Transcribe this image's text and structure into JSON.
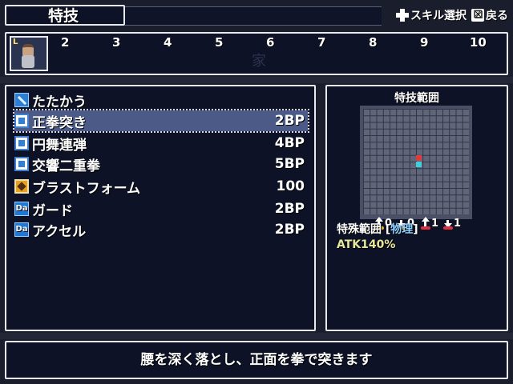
{
  "header": {
    "title": "特技"
  },
  "controls": {
    "skill_select": "スキル選択",
    "back": "戻る"
  },
  "party": {
    "slots": [
      "2",
      "3",
      "4",
      "5",
      "6",
      "7",
      "8",
      "9",
      "10"
    ],
    "leader_badge": "L",
    "ghost_char": "家"
  },
  "skills": [
    {
      "name": "たたかう",
      "cost": "",
      "icon": "sword-icon"
    },
    {
      "name": "正拳突き",
      "cost": "2BP",
      "icon": "fist-skill-icon",
      "selected": true
    },
    {
      "name": "円舞連弾",
      "cost": "4BP",
      "icon": "fist-skill-icon"
    },
    {
      "name": "交響二重拳",
      "cost": "5BP",
      "icon": "fist-skill-icon"
    },
    {
      "name": "ブラストフォーム",
      "cost": "100",
      "icon": "blast-icon"
    },
    {
      "name": "ガード",
      "cost": "2BP",
      "icon": "da-icon"
    },
    {
      "name": "アクセル",
      "cost": "2BP",
      "icon": "da-icon"
    }
  ],
  "range_panel": {
    "title": "特技範囲",
    "stats": [
      {
        "icon": "atk-up-icon",
        "value": "0",
        "color": "#f0b020"
      },
      {
        "icon": "atk-down-icon",
        "value": "0",
        "color": "#f0b020"
      },
      {
        "icon": "def-up-icon",
        "value": "1",
        "color": "#e03040"
      },
      {
        "icon": "def-down-icon",
        "value": "1",
        "color": "#e03040"
      }
    ],
    "range_label": "特殊範囲",
    "bracket_open": "[",
    "range_type": "物理",
    "bracket_close": "]",
    "atk_text": "ATK140%",
    "grid_cells": [
      {
        "color": "#e03a3a"
      },
      {
        "color": "#3ad0e0"
      }
    ]
  },
  "description": {
    "text": "腰を深く落とし、正面を拳で突きます"
  },
  "colors": {
    "window_bg": "#0d1226",
    "window_border": "#e8e8f0",
    "selection": "#4b5a86",
    "range_type": "#8fd0ff",
    "atk": "#e6e89a"
  }
}
